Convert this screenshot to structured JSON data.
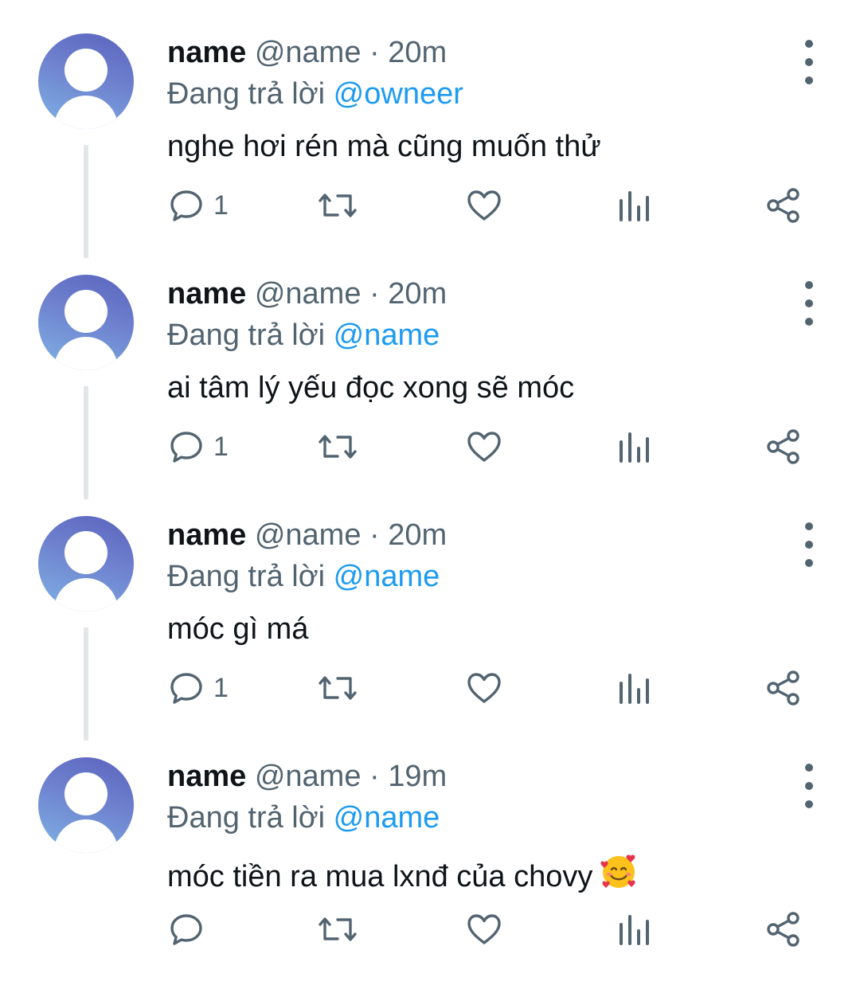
{
  "tweets": [
    {
      "display_name": "name",
      "handle": "@name",
      "separator": "·",
      "time": "20m",
      "reply_prefix": "Đang trả lời",
      "reply_to": "@owneer",
      "text": "nghe hơi rén mà cũng muốn thử",
      "reply_count": "1",
      "has_thread_line": true
    },
    {
      "display_name": "name",
      "handle": "@name",
      "separator": "·",
      "time": "20m",
      "reply_prefix": "Đang trả lời",
      "reply_to": "@name",
      "text": "ai tâm lý yếu đọc xong sẽ móc",
      "reply_count": "1",
      "has_thread_line": true
    },
    {
      "display_name": "name",
      "handle": "@name",
      "separator": "·",
      "time": "20m",
      "reply_prefix": "Đang trả lời",
      "reply_to": "@name",
      "text": "móc gì má",
      "reply_count": "1",
      "has_thread_line": true
    },
    {
      "display_name": "name",
      "handle": "@name",
      "separator": "·",
      "time": "19m",
      "reply_prefix": "Đang trả lời",
      "reply_to": "@name",
      "text": "móc tiền ra mua lxnđ của chovy",
      "emoji": "smiling-face-with-hearts",
      "reply_count": "",
      "has_thread_line": false
    }
  ],
  "icons": {
    "reply": "reply-icon",
    "retweet": "retweet-icon",
    "like": "heart-icon",
    "views": "views-icon",
    "share": "share-icon",
    "more": "more-vertical-icon"
  },
  "colors": {
    "text": "#0f1419",
    "secondary": "#536471",
    "mention": "#1d9bf0",
    "thread_line": "#e3e6e9"
  }
}
